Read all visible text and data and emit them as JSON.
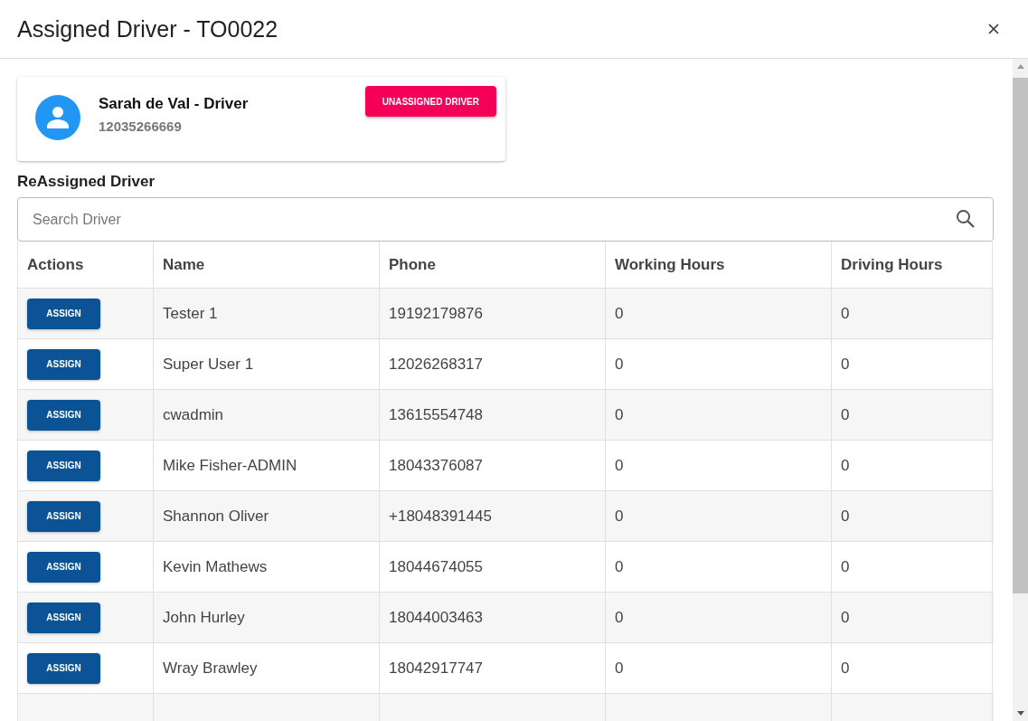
{
  "dialog": {
    "title": "Assigned Driver - TO0022"
  },
  "current_driver": {
    "name": "Sarah de Val - Driver",
    "phone": "12035266669",
    "unassign_button": "UNASSIGNED DRIVER"
  },
  "reassign": {
    "heading": "ReAssigned Driver",
    "search": {
      "placeholder": "Search Driver"
    }
  },
  "table": {
    "columns": [
      "Actions",
      "Name",
      "Phone",
      "Working Hours",
      "Driving Hours"
    ],
    "rows": [
      {
        "action": "ASSIGN",
        "name": "Tester 1",
        "phone": "19192179876",
        "working_hours": "0",
        "driving_hours": "0"
      },
      {
        "action": "ASSIGN",
        "name": "Super User 1",
        "phone": "12026268317",
        "working_hours": "0",
        "driving_hours": "0"
      },
      {
        "action": "ASSIGN",
        "name": "cwadmin",
        "phone": "13615554748",
        "working_hours": "0",
        "driving_hours": "0"
      },
      {
        "action": "ASSIGN",
        "name": "Mike Fisher-ADMIN",
        "phone": "18043376087",
        "working_hours": "0",
        "driving_hours": "0"
      },
      {
        "action": "ASSIGN",
        "name": "Shannon Oliver",
        "phone": "+18048391445",
        "working_hours": "0",
        "driving_hours": "0"
      },
      {
        "action": "ASSIGN",
        "name": "Kevin Mathews",
        "phone": "18044674055",
        "working_hours": "0",
        "driving_hours": "0"
      },
      {
        "action": "ASSIGN",
        "name": "John Hurley",
        "phone": "18044003463",
        "working_hours": "0",
        "driving_hours": "0"
      },
      {
        "action": "ASSIGN",
        "name": "Wray Brawley",
        "phone": "18042917747",
        "working_hours": "0",
        "driving_hours": "0"
      }
    ]
  }
}
